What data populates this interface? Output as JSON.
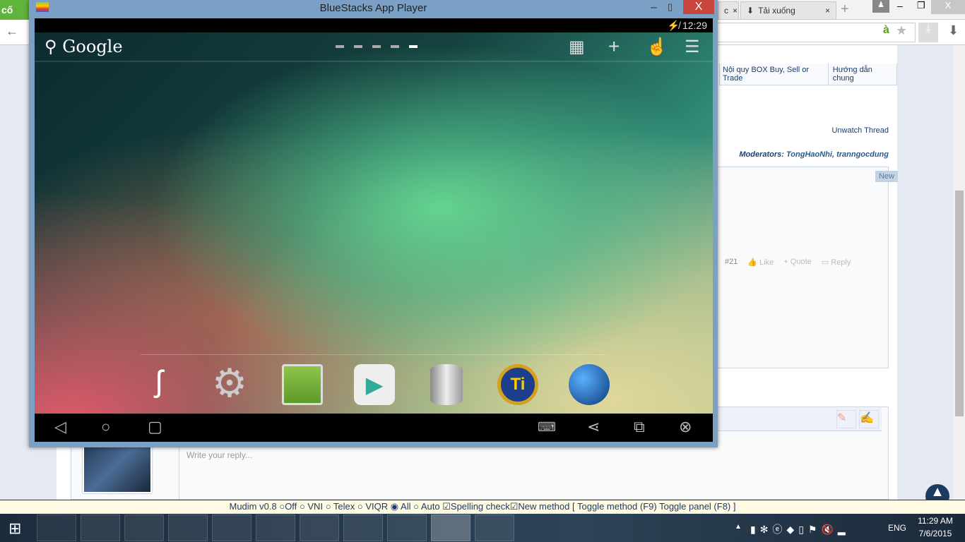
{
  "browser": {
    "tab1_label": "cố",
    "tab2_label": "c",
    "tab3_label": "Tải xuống",
    "close": "×",
    "new_tab": "+",
    "addr_icon": "à"
  },
  "forum": {
    "tabs": [
      "Nội quy BOX Buy, Sell or Trade",
      "Hướng dẫn chung"
    ],
    "unwatch": "Unwatch Thread",
    "moderators_label": "Moderators:",
    "moderators": "TongHaoNhi, tranngocdung",
    "new_badge": "New",
    "post_number": "#21",
    "like": "Like",
    "quote": "+ Quote",
    "reply": "Reply",
    "reply_placeholder": "Write your reply..."
  },
  "bluestacks": {
    "title": "BlueStacks App Player",
    "time": "12:29",
    "google": "Google",
    "dock_apps": [
      "Sketch app",
      "Settings",
      "Android app",
      "Play Store",
      "Storage",
      "Titanium Backup",
      "Browser globe"
    ]
  },
  "mudim": {
    "text": "Mudim v0.8",
    "options": [
      "Off",
      "VNI",
      "Telex",
      "VIQR",
      "All",
      "Auto"
    ],
    "selected": "All",
    "spelling": "Spelling check",
    "new_method": "New method",
    "toggles": "[ Toggle method (F9) Toggle panel (F8) ]"
  },
  "taskbar": {
    "lang": "ENG",
    "time": "11:29 AM",
    "date": "7/6/2015"
  }
}
